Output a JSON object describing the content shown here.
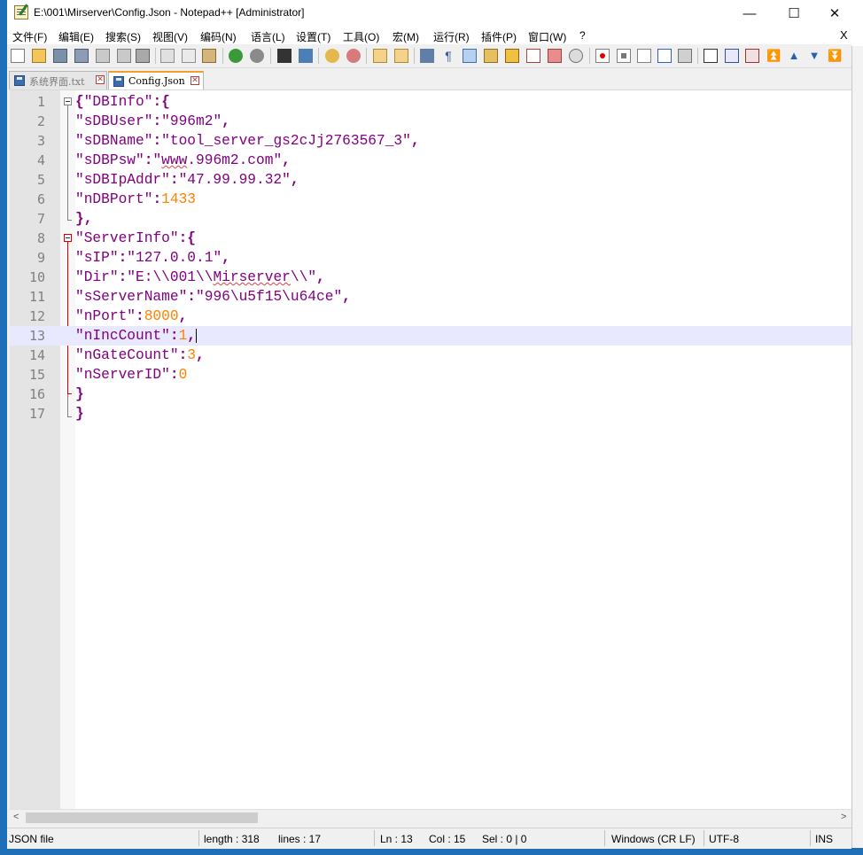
{
  "window": {
    "title": "E:\\001\\Mirserver\\Config.Json - Notepad++ [Administrator]",
    "minimize_glyph": "—",
    "maximize_glyph": "☐",
    "close_glyph": "✕"
  },
  "menubar": {
    "items": [
      "文件(F)",
      "编辑(E)",
      "搜索(S)",
      "视图(V)",
      "编码(N)",
      "语言(L)",
      "设置(T)",
      "工具(O)",
      "宏(M)",
      "运行(R)",
      "插件(P)",
      "窗口(W)",
      "?"
    ],
    "close_glyph": "X"
  },
  "toolbar": {
    "icons": [
      "new-file-icon",
      "open-file-icon",
      "save-icon",
      "save-all-icon",
      "close-icon",
      "close-all-icon",
      "print-icon",
      "cut-icon",
      "copy-icon",
      "paste-icon",
      "undo-icon",
      "redo-icon",
      "find-icon",
      "replace-icon",
      "zoom-in-icon",
      "zoom-out-icon",
      "sync-vertical-icon",
      "sync-horizontal-icon",
      "word-wrap-icon",
      "show-all-chars-icon",
      "indent-guide-icon",
      "user-language-icon",
      "document-map-icon",
      "function-list-icon",
      "folder-workspace-icon",
      "monitoring-icon",
      "record-macro-icon",
      "stop-record-icon",
      "play-macro-icon",
      "run-macro-multiple-icon",
      "save-macro-icon",
      "plugin-icon-1",
      "plugin-icon-2",
      "plugin-icon-3",
      "plugin-icon-4",
      "plugin-icon-5",
      "plugin-icon-6"
    ]
  },
  "tabs": [
    {
      "label": "系统界面.txt",
      "active": false
    },
    {
      "label": "Config.Json",
      "active": true
    }
  ],
  "editor": {
    "current_line": 13,
    "lines": [
      {
        "n": "1",
        "text": "{\"DBInfo\":{"
      },
      {
        "n": "2",
        "text": "\"sDBUser\":\"996m2\","
      },
      {
        "n": "3",
        "text": "\"sDBName\":\"tool_server_gs2cJj2763567_3\","
      },
      {
        "n": "4",
        "text": "\"sDBPsw\":\"www.996m2.com\","
      },
      {
        "n": "5",
        "text": "\"sDBIpAddr\":\"47.99.99.32\","
      },
      {
        "n": "6",
        "text": "\"nDBPort\":1433"
      },
      {
        "n": "7",
        "text": "},"
      },
      {
        "n": "8",
        "text": "\"ServerInfo\":{"
      },
      {
        "n": "9",
        "text": "\"sIP\":\"127.0.0.1\","
      },
      {
        "n": "10",
        "text": "\"Dir\":\"E:\\\\001\\\\Mirserver\\\\\","
      },
      {
        "n": "11",
        "text": "\"sServerName\":\"996\\u5f15\\u64ce\","
      },
      {
        "n": "12",
        "text": "\"nPort\":8000,"
      },
      {
        "n": "13",
        "text": "\"nIncCount\":1,"
      },
      {
        "n": "14",
        "text": "\"nGateCount\":3,"
      },
      {
        "n": "15",
        "text": "\"nServerID\":0"
      },
      {
        "n": "16",
        "text": "}"
      },
      {
        "n": "17",
        "text": "}"
      }
    ]
  },
  "statusbar": {
    "file_type": "JSON file",
    "length": "length : 318",
    "lines": "lines : 17",
    "ln": "Ln : 13",
    "col": "Col : 15",
    "sel": "Sel : 0 | 0",
    "eol": "Windows (CR LF)",
    "encoding": "UTF-8",
    "mode": "INS"
  },
  "colors": {
    "string": "#800080",
    "number": "#ff8000",
    "current_line": "#e8e8ff",
    "line_number": "#808080"
  }
}
